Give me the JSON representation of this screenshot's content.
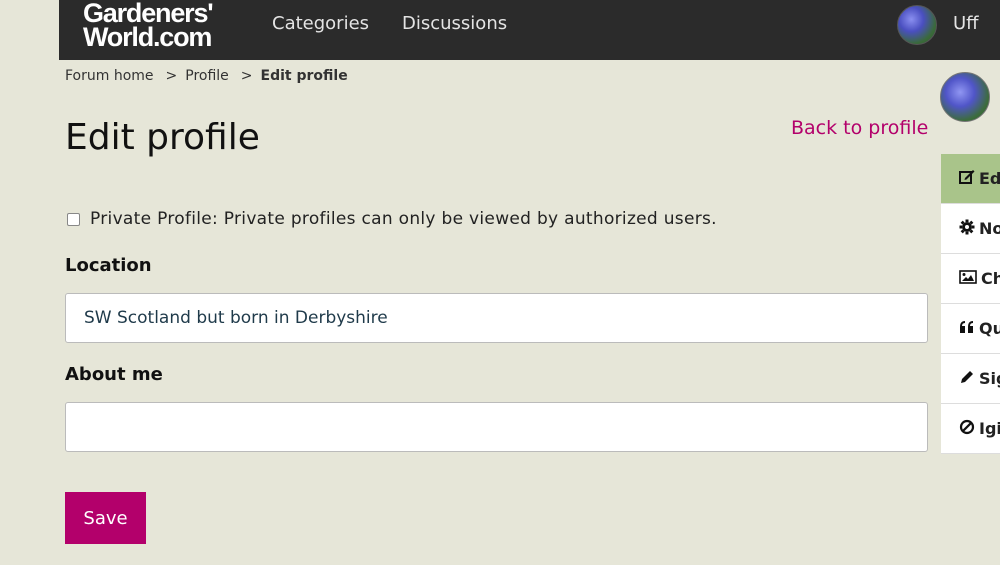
{
  "header": {
    "logo_line1": "Gardeners'",
    "logo_line2": "World.com",
    "nav": [
      {
        "label": "Categories"
      },
      {
        "label": "Discussions"
      }
    ],
    "username": "Uff"
  },
  "breadcrumb": {
    "items": [
      "Forum home",
      "Profile",
      "Edit profile"
    ],
    "separator": ">"
  },
  "page": {
    "title": "Edit profile",
    "back_link": "Back to profile"
  },
  "form": {
    "private_profile_label": "Private Profile: Private profiles can only be viewed by authorized users.",
    "private_profile_checked": false,
    "location_label": "Location",
    "location_value": "SW Scotland but born in Derbyshire",
    "about_label": "About me",
    "about_value": "",
    "save_label": "Save"
  },
  "side_menu": {
    "items": [
      {
        "label": "Ed",
        "icon": "edit-icon",
        "active": true
      },
      {
        "label": "No",
        "icon": "gear-icon",
        "active": false
      },
      {
        "label": "Ch",
        "icon": "image-icon",
        "active": false
      },
      {
        "label": "Qu",
        "icon": "quote-icon",
        "active": false
      },
      {
        "label": "Sig",
        "icon": "pencil-icon",
        "active": false
      },
      {
        "label": "Igi",
        "icon": "ban-icon",
        "active": false
      }
    ]
  },
  "colors": {
    "accent": "#b3006b",
    "header_bg": "#2b2b2b",
    "page_bg": "#e6e6d8",
    "active_menu_bg": "#a9c48a"
  }
}
